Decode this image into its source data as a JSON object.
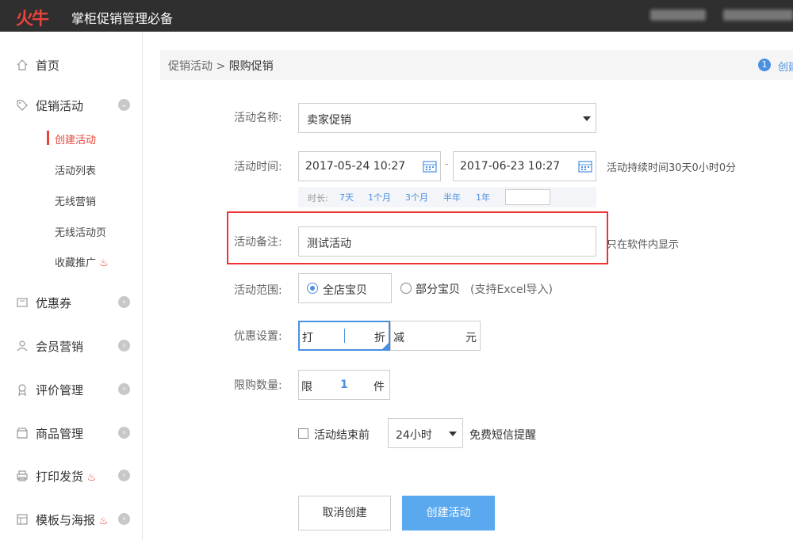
{
  "header": {
    "logo_text": "火牛",
    "app_title": "掌柜促销管理必备"
  },
  "sidebar": {
    "home": "首页",
    "promo": "促销活动",
    "sub_items": [
      "创建活动",
      "活动列表",
      "无线营销",
      "无线活动页",
      "收藏推广"
    ],
    "coupons": "优惠券",
    "member": "会员营销",
    "review": "评价管理",
    "goods": "商品管理",
    "print": "打印发货",
    "template": "模板与海报"
  },
  "breadcrumb": {
    "parent": "促销活动",
    "separator": ">",
    "current": "限购促销",
    "step_num": "1",
    "step_text": "创建"
  },
  "form": {
    "name_label": "活动名称:",
    "name_value": "卖家促销",
    "time_label": "活动时间:",
    "start_time": "2017-05-24 10:27",
    "time_sep": "-",
    "end_time": "2017-06-23 10:27",
    "duration_text": "活动持续时间30天0小时0分",
    "duration_label": "时长:",
    "duration_options": [
      "7天",
      "1个月",
      "3个月",
      "半年",
      "1年"
    ],
    "note_label": "活动备注:",
    "note_value": "测试活动",
    "note_hint": "只在软件内显示",
    "scope_label": "活动范围:",
    "scope_all": "全店宝贝",
    "scope_part": "部分宝贝",
    "scope_part_hint": "(支持Excel导入)",
    "discount_label": "优惠设置:",
    "discount_da": "打",
    "discount_zhe": "折",
    "discount_jian": "减",
    "discount_yuan": "元",
    "limit_label": "限购数量:",
    "limit_xian": "限",
    "limit_value": "1",
    "limit_jian": "件",
    "reminder_label": "活动结束前",
    "reminder_value": "24小时",
    "reminder_suffix": "免费短信提醒",
    "cancel_btn": "取消创建",
    "create_btn": "创建活动"
  }
}
